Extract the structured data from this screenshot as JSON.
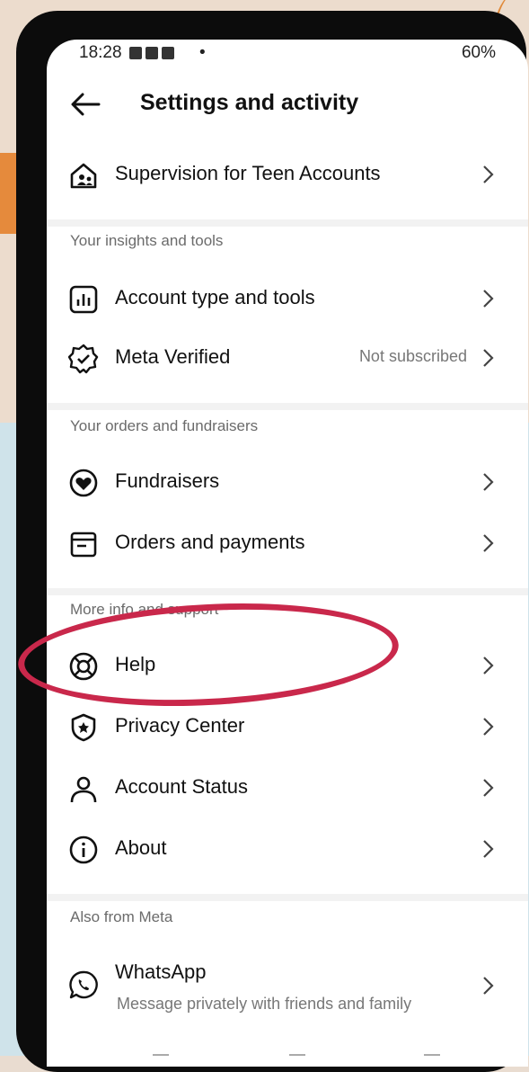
{
  "status_bar": {
    "time": "18:28",
    "dot": "•",
    "right": "60%"
  },
  "header": {
    "title": "Settings and activity"
  },
  "items": {
    "supervision": {
      "label": "Supervision for Teen Accounts"
    },
    "account_type": {
      "label": "Account type and tools"
    },
    "meta_verified": {
      "label": "Meta Verified",
      "meta": "Not subscribed"
    },
    "fundraisers": {
      "label": "Fundraisers"
    },
    "orders": {
      "label": "Orders and payments"
    },
    "help": {
      "label": "Help"
    },
    "privacy": {
      "label": "Privacy Center"
    },
    "account_status": {
      "label": "Account Status"
    },
    "about": {
      "label": "About"
    },
    "whatsapp": {
      "label": "WhatsApp",
      "sub": "Message privately with friends and family"
    }
  },
  "sections": {
    "insights": "Your insights and tools",
    "orders": "Your orders and fundraisers",
    "more": "More info and support",
    "also": "Also from Meta"
  },
  "colors": {
    "annotation": "#c9284b",
    "background_peach": "#ecdccd",
    "background_blue": "#cfe3ea",
    "accent_orange": "#e58a3c"
  },
  "icons": [
    "back-arrow-icon",
    "teen-supervision-icon",
    "bar-chart-icon",
    "verified-badge-icon",
    "fundraiser-heart-icon",
    "receipt-icon",
    "lifebuoy-icon",
    "shield-star-icon",
    "person-icon",
    "info-icon",
    "whatsapp-icon",
    "chevron-right-icon"
  ]
}
